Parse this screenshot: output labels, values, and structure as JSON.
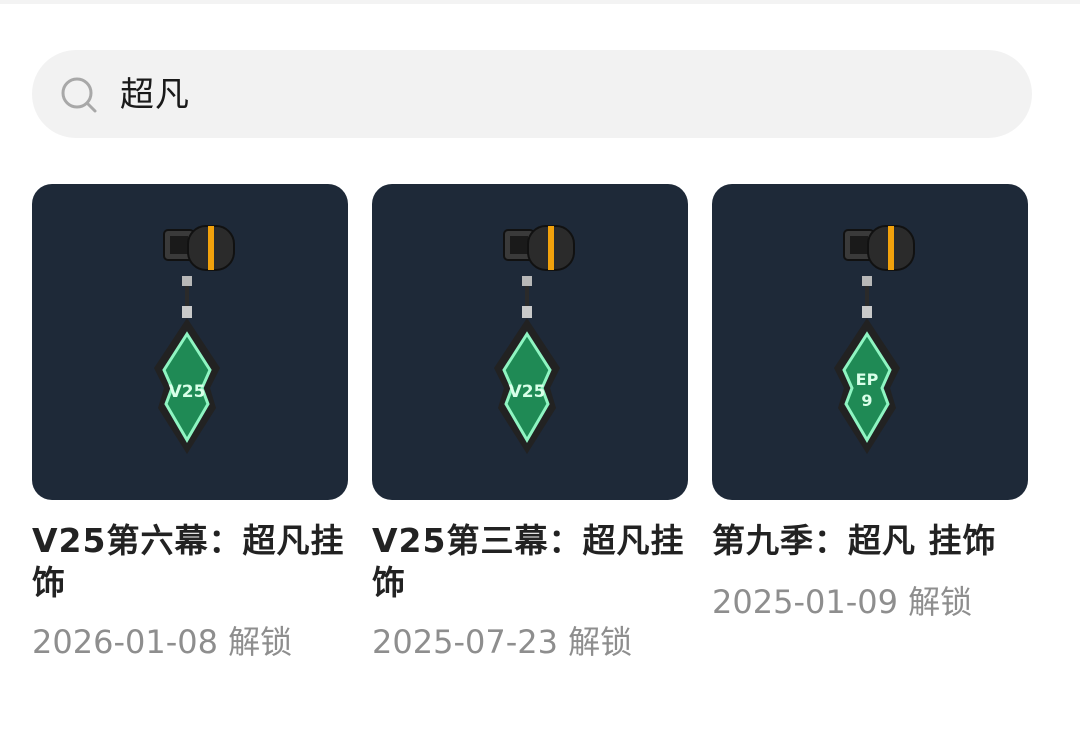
{
  "search": {
    "value": "超凡",
    "icon": "search-icon"
  },
  "items": [
    {
      "title": "V25第六幕：超凡挂饰",
      "unlock": "2026-01-08 解锁",
      "emblem": "V25"
    },
    {
      "title": "V25第三幕：超凡挂饰",
      "unlock": "2025-07-23 解锁",
      "emblem": "V25"
    },
    {
      "title": "第九季：超凡 挂饰",
      "unlock": "2025-01-09 解锁",
      "emblem": [
        "EP",
        "9"
      ]
    }
  ],
  "colors": {
    "thumb_bg": "#1e2938",
    "gem": "#1f8a55",
    "gem_glow": "#8ff5c2",
    "ring": "#f2a20c"
  }
}
